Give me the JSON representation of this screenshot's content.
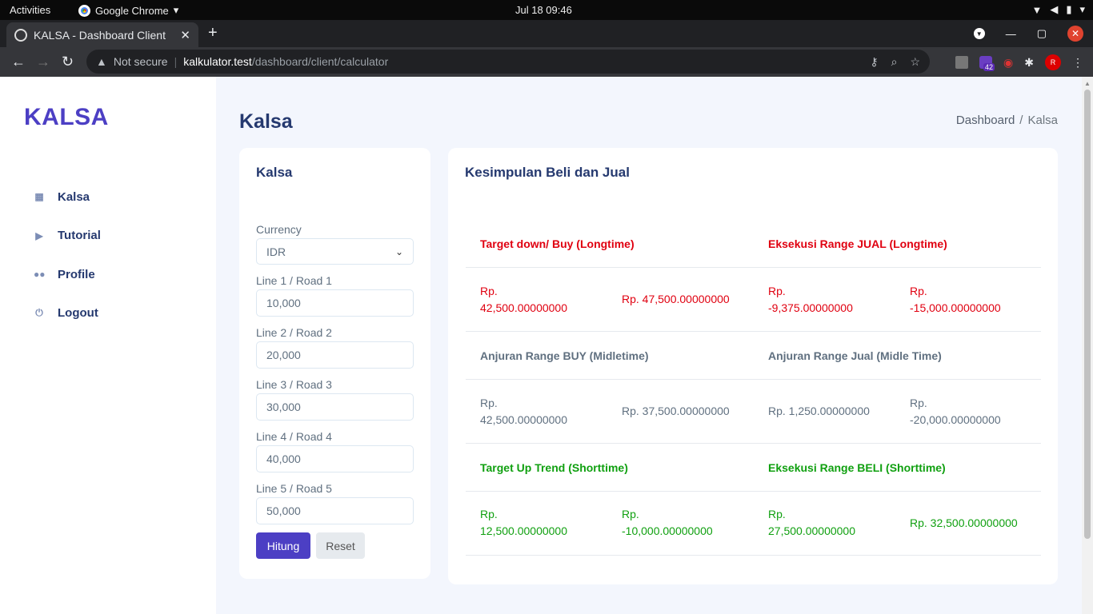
{
  "system": {
    "activities": "Activities",
    "app_name": "Google Chrome",
    "clock": "Jul 18  09:46"
  },
  "browser": {
    "tab_title": "KALSA - Dashboard Client",
    "not_secure": "Not secure",
    "url_host": "kalkulator.test",
    "url_path": "/dashboard/client/calculator",
    "ext_badge": "42"
  },
  "sidebar": {
    "brand": "KALSA",
    "items": [
      {
        "label": "Kalsa",
        "icon": "calculator-icon"
      },
      {
        "label": "Tutorial",
        "icon": "video-icon"
      },
      {
        "label": "Profile",
        "icon": "users-icon"
      },
      {
        "label": "Logout",
        "icon": "power-icon"
      }
    ]
  },
  "header": {
    "title": "Kalsa",
    "breadcrumb": [
      "Dashboard",
      "Kalsa"
    ],
    "breadcrumb_sep": "/"
  },
  "form": {
    "title": "Kalsa",
    "currency_label": "Currency",
    "currency_value": "IDR",
    "lines": [
      {
        "label": "Line 1 / Road 1",
        "value": "10,000"
      },
      {
        "label": "Line 2 / Road 2",
        "value": "20,000"
      },
      {
        "label": "Line 3 / Road 3",
        "value": "30,000"
      },
      {
        "label": "Line 4 / Road 4",
        "value": "40,000"
      },
      {
        "label": "Line 5 / Road 5",
        "value": "50,000"
      }
    ],
    "submit_label": "Hitung",
    "reset_label": "Reset"
  },
  "summary": {
    "title": "Kesimpulan Beli dan Jual",
    "sections": [
      {
        "color": "#e00010",
        "left_head": "Target down/ Buy (Longtime)",
        "right_head": "Eksekusi Range JUAL (Longtime)",
        "values": [
          "Rp.\n42,500.00000000",
          "Rp. 47,500.00000000",
          "Rp.\n-9,375.00000000",
          "Rp.\n-15,000.00000000"
        ]
      },
      {
        "color": "#607080",
        "left_head": "Anjuran Range BUY (Midletime)",
        "right_head": "Anjuran Range Jual (Midle Time)",
        "values": [
          "Rp.\n42,500.00000000",
          "Rp. 37,500.00000000",
          "Rp. 1,250.00000000",
          "Rp.\n-20,000.00000000"
        ]
      },
      {
        "color": "#10a010",
        "left_head": "Target Up Trend (Shorttime)",
        "right_head": "Eksekusi Range BELI (Shorttime)",
        "values": [
          "Rp.\n12,500.00000000",
          "Rp.\n-10,000.00000000",
          "Rp.\n27,500.00000000",
          "Rp. 32,500.00000000"
        ]
      }
    ]
  }
}
